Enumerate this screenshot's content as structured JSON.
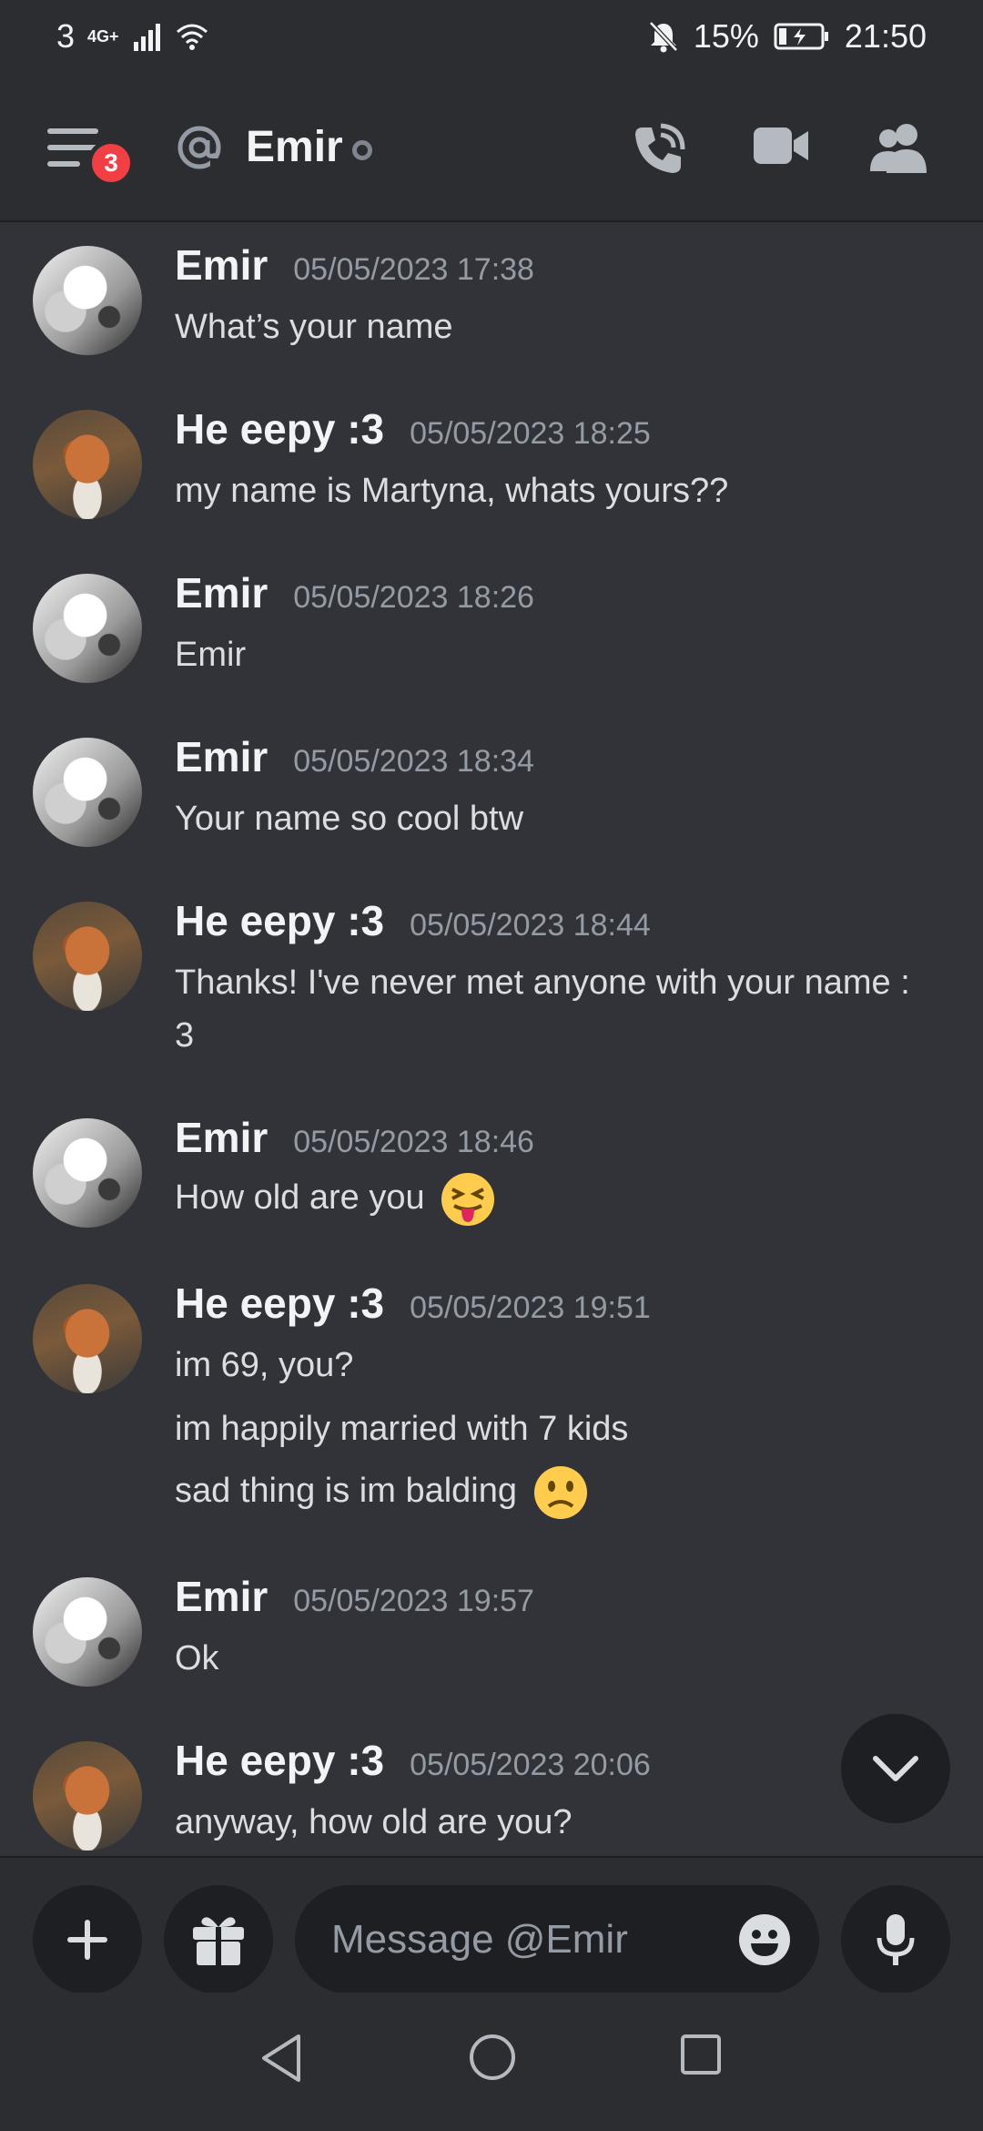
{
  "status_bar": {
    "sim": "3",
    "network": "4G+",
    "battery": "15%",
    "time": "21:50"
  },
  "header": {
    "title": "Emir",
    "badge_count": "3",
    "icons": [
      "menu-icon",
      "at-icon",
      "phone-call-icon",
      "video-call-icon",
      "members-icon"
    ]
  },
  "messages": [
    {
      "author": "Emir",
      "timestamp": "05/05/2023 17:38",
      "avatar": "emir",
      "lines": [
        "What’s your name"
      ]
    },
    {
      "author": "He eepy :3",
      "timestamp": "05/05/2023 18:25",
      "avatar": "cat",
      "lines": [
        "my name is Martyna, whats yours??"
      ]
    },
    {
      "author": "Emir",
      "timestamp": "05/05/2023 18:26",
      "avatar": "emir",
      "lines": [
        "Emir"
      ]
    },
    {
      "author": "Emir",
      "timestamp": "05/05/2023 18:34",
      "avatar": "emir",
      "lines": [
        "Your name so cool btw"
      ]
    },
    {
      "author": "He eepy :3",
      "timestamp": "05/05/2023 18:44",
      "avatar": "cat",
      "lines": [
        "Thanks! I've never met anyone with your name :",
        "3"
      ]
    },
    {
      "author": "Emir",
      "timestamp": "05/05/2023 18:46",
      "avatar": "emir",
      "lines": [
        "How old are you"
      ],
      "emoji": "squinting-tongue-emoji"
    },
    {
      "author": "He eepy :3",
      "timestamp": "05/05/2023 19:51",
      "avatar": "cat",
      "lines": [
        "im 69, you?",
        "im happily married with 7 kids",
        "sad thing is im balding"
      ],
      "emoji": "frowning-face-emoji"
    },
    {
      "author": "Emir",
      "timestamp": "05/05/2023 19:57",
      "avatar": "emir",
      "lines": [
        "Ok"
      ]
    },
    {
      "author": "He eepy :3",
      "timestamp": "05/05/2023 20:06",
      "avatar": "cat",
      "lines": [
        "anyway, how old are you?"
      ]
    }
  ],
  "composer": {
    "placeholder": "Message @Emir"
  },
  "colors": {
    "background": "#313338",
    "header": "#2b2d31",
    "badge": "#f23f43",
    "input": "#1e1f22"
  }
}
